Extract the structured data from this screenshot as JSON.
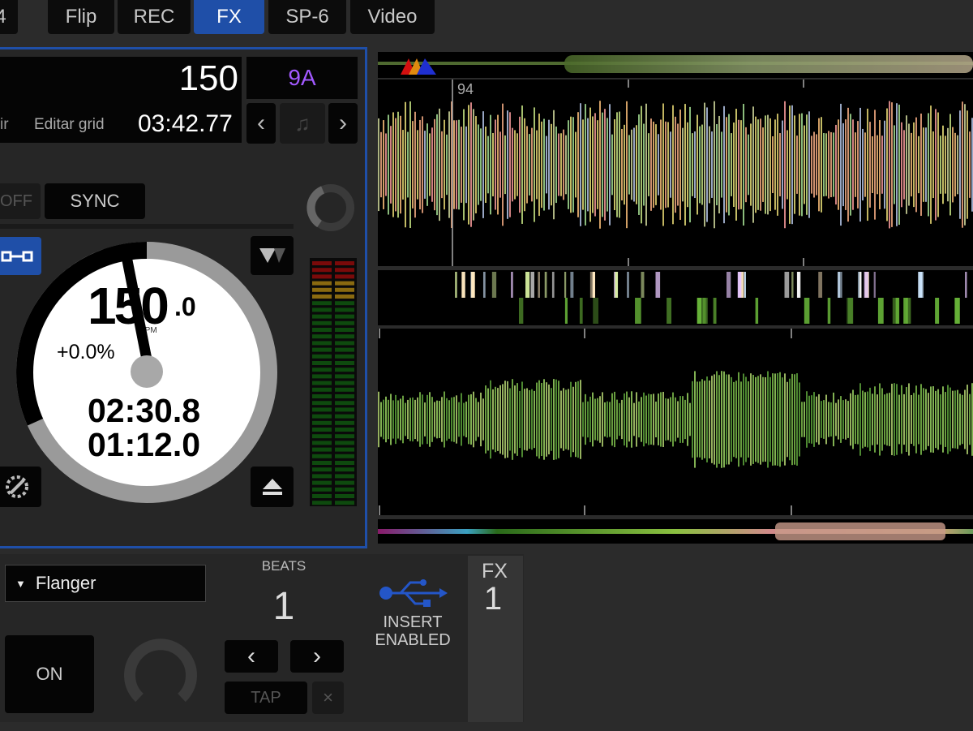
{
  "tabs": [
    {
      "label": "4"
    },
    {
      "label": "Flip"
    },
    {
      "label": "REC"
    },
    {
      "label": "FX",
      "active": true
    },
    {
      "label": "SP-6"
    },
    {
      "label": "Video"
    }
  ],
  "deck": {
    "bpm": "150",
    "key": "9A",
    "left_label": "ir",
    "edit_grid": "Editar grid",
    "track_length": "03:42.77",
    "sync_off": "OFF",
    "sync": "SYNC",
    "platter": {
      "bpm_int": "150",
      "bpm_dec": ".0",
      "bpm_unit": "BPM",
      "pitch": "+0.0%",
      "elapsed": "02:30.8",
      "remaining": "01:12.0"
    }
  },
  "waveform": {
    "beat_marker_label": "94"
  },
  "fx": {
    "effect_name": "Flanger",
    "on_label": "ON",
    "beats_label": "BEATS",
    "beats_value": "1",
    "tap_label": "TAP",
    "clear_label": "×",
    "insert_line1": "INSERT",
    "insert_line2": "ENABLED",
    "unit_label": "FX",
    "unit_number": "1"
  },
  "colors": {
    "accent": "#1f4fa8",
    "key": "#a259ff",
    "usb": "#2456c8"
  }
}
